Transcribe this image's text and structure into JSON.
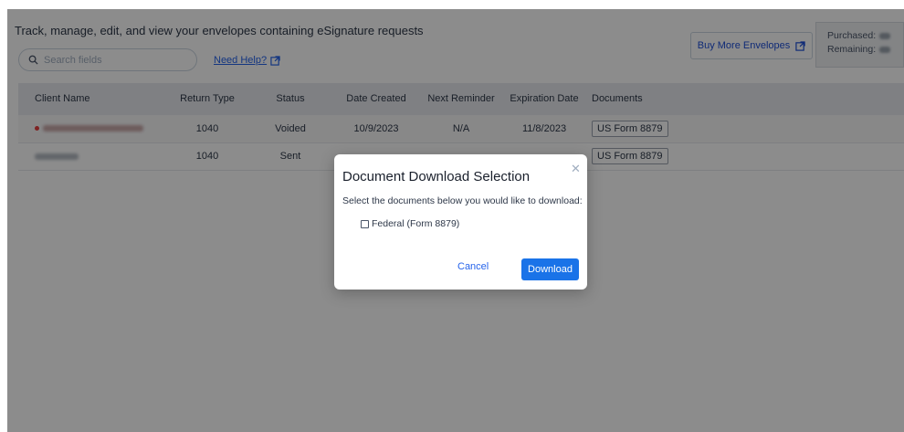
{
  "header": {
    "title": "Track, manage, edit, and view your envelopes containing eSignature requests",
    "search_placeholder": "Search fields",
    "help_link": "Need Help?",
    "buy_button": "Buy More Envelopes",
    "purchased_label": "Purchased:",
    "remaining_label": "Remaining:"
  },
  "table": {
    "columns": [
      "Client Name",
      "Return Type",
      "Status",
      "Date Created",
      "Next Reminder",
      "Expiration Date",
      "Documents"
    ],
    "rows": [
      {
        "return_type": "1040",
        "status": "Voided",
        "date_created": "10/9/2023",
        "next_reminder": "N/A",
        "expiration_date": "11/8/2023",
        "document": "US Form 8879"
      },
      {
        "return_type": "1040",
        "status": "Sent",
        "date_created": "",
        "next_reminder": "",
        "expiration_date": "",
        "document": "US Form 8879"
      }
    ]
  },
  "modal": {
    "title": "Document Download Selection",
    "instruction": "Select the documents below you would like to download:",
    "option_label": "Federal (Form 8879)",
    "cancel_label": "Cancel",
    "download_label": "Download"
  },
  "colors": {
    "accent": "#1a73e8",
    "voided": "#d62828",
    "header_bg": "#e8eaee"
  }
}
